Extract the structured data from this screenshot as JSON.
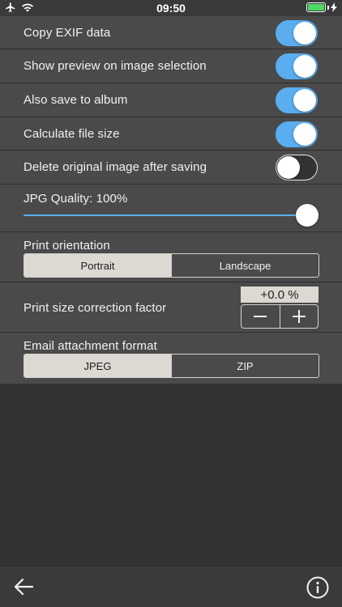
{
  "status_bar": {
    "time": "09:50",
    "icons": [
      "airplane-icon",
      "wifi-icon",
      "battery-icon",
      "charging-bolt-icon"
    ],
    "battery_level": 1.0,
    "battery_color": "#4cd964"
  },
  "settings": {
    "copy_exif": {
      "label": "Copy EXIF data",
      "on": true
    },
    "show_preview": {
      "label": "Show preview on image selection",
      "on": true
    },
    "save_album": {
      "label": "Also save to album",
      "on": true
    },
    "file_size": {
      "label": "Calculate file size",
      "on": true
    },
    "delete_original": {
      "label": "Delete original image after saving",
      "on": false
    },
    "jpg_quality": {
      "label": "JPG Quality: 100%",
      "value": 1.0
    },
    "print_orientation": {
      "label": "Print orientation",
      "options": [
        "Portrait",
        "Landscape"
      ],
      "selected": "Portrait"
    },
    "print_size": {
      "label": "Print size correction factor",
      "value": "+0.0 %",
      "decrement_icon": "minus-icon",
      "increment_icon": "plus-icon"
    },
    "email_format": {
      "label": "Email attachment format",
      "options": [
        "JPEG",
        "ZIP"
      ],
      "selected": "JPEG"
    }
  },
  "toolbar": {
    "back_icon": "back-arrow-icon",
    "info_icon": "info-icon"
  },
  "colors": {
    "accent": "#5aaef0",
    "panel": "#4a4a4a",
    "background": "#333333",
    "segment_selected": "#dcd8d2"
  }
}
